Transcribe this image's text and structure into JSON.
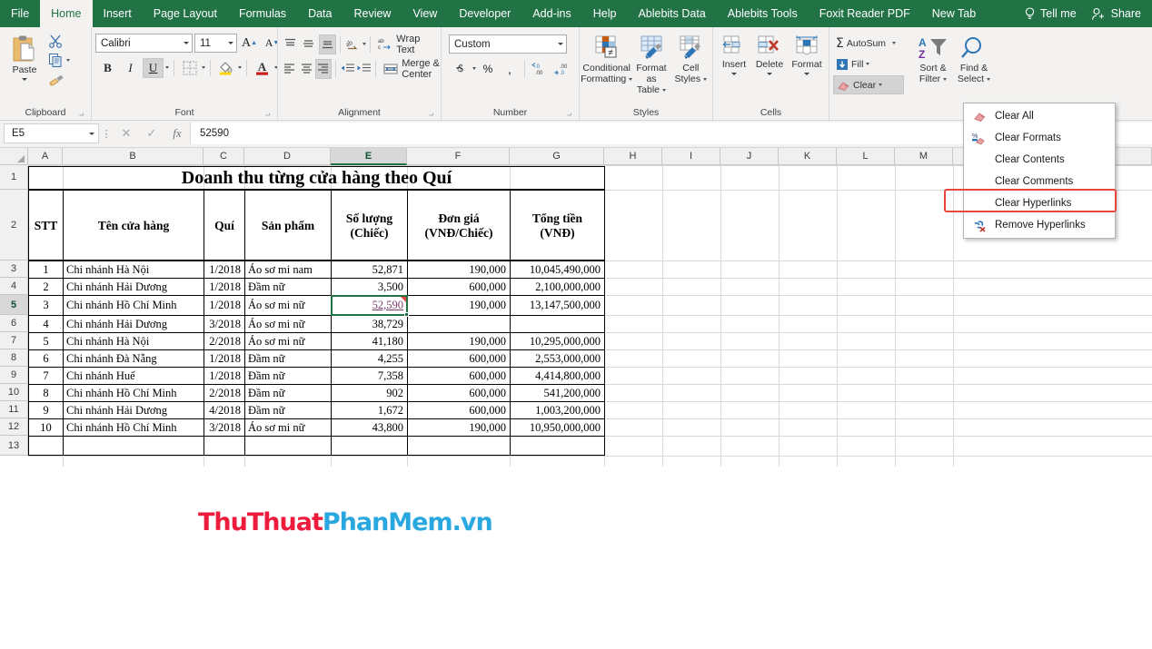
{
  "ribbon_tabs": [
    {
      "label": "File",
      "active": false
    },
    {
      "label": "Home",
      "active": true
    },
    {
      "label": "Insert",
      "active": false
    },
    {
      "label": "Page Layout",
      "active": false
    },
    {
      "label": "Formulas",
      "active": false
    },
    {
      "label": "Data",
      "active": false
    },
    {
      "label": "Review",
      "active": false
    },
    {
      "label": "View",
      "active": false
    },
    {
      "label": "Developer",
      "active": false
    },
    {
      "label": "Add-ins",
      "active": false
    },
    {
      "label": "Help",
      "active": false
    },
    {
      "label": "Ablebits Data",
      "active": false
    },
    {
      "label": "Ablebits Tools",
      "active": false
    },
    {
      "label": "Foxit Reader PDF",
      "active": false
    },
    {
      "label": "New Tab",
      "active": false
    }
  ],
  "titlebar": {
    "tell_me": "Tell me",
    "share": "Share"
  },
  "ribbon": {
    "clipboard": {
      "label": "Clipboard",
      "paste": "Paste",
      "cut": "Cut",
      "copy": "Copy",
      "format_painter": "Format Painter"
    },
    "font": {
      "label": "Font",
      "font_name": "Calibri",
      "font_size": "11",
      "grow_font": "A",
      "shrink_font": "A",
      "bold": "B",
      "italic": "I",
      "underline": "U"
    },
    "alignment": {
      "label": "Alignment",
      "wrap_text": "Wrap Text",
      "merge_center": "Merge & Center"
    },
    "number": {
      "label": "Number",
      "format": "Custom",
      "currency": "$",
      "percent": "%",
      "comma": ",",
      "decrease_decimal": ".00",
      "increase_decimal": ".00"
    },
    "styles": {
      "label": "Styles",
      "conditional_formatting": "Conditional\nFormatting",
      "conditional_line1": "Conditional",
      "conditional_line2": "Formatting",
      "format_as_table_line1": "Format as",
      "format_as_table_line2": "Table",
      "cell_styles_line1": "Cell",
      "cell_styles_line2": "Styles"
    },
    "cells": {
      "label": "Cells",
      "insert": "Insert",
      "delete": "Delete",
      "format": "Format"
    },
    "editing": {
      "autosum": "AutoSum",
      "fill": "Fill",
      "clear": "Clear",
      "sort_filter_line1": "Sort &",
      "sort_filter_line2": "Filter",
      "find_select_line1": "Find &",
      "find_select_line2": "Select"
    }
  },
  "clear_menu": {
    "items": [
      {
        "label": "Clear All",
        "icon": "eraser-icon",
        "highlighted": false
      },
      {
        "label": "Clear Formats",
        "icon": "clear-formats-icon",
        "highlighted": false
      },
      {
        "label": "Clear Contents",
        "icon": "none",
        "highlighted": false
      },
      {
        "label": "Clear Comments",
        "icon": "none",
        "highlighted": false
      },
      {
        "label": "Clear Hyperlinks",
        "icon": "none",
        "highlighted": true
      },
      {
        "label": "Remove Hyperlinks",
        "icon": "remove-hyperlink-icon",
        "highlighted": false
      }
    ],
    "highlight_color": "#e8453c"
  },
  "formula_bar": {
    "name_box": "E5",
    "cancel": "✕",
    "enter": "✓",
    "insert_function": "fx",
    "value": "52590"
  },
  "sheet": {
    "columns": [
      "A",
      "B",
      "C",
      "D",
      "E",
      "F",
      "G",
      "H",
      "I",
      "J",
      "K",
      "L",
      "M"
    ],
    "selected_column": "E",
    "rows": [
      "1",
      "2",
      "3",
      "4",
      "5",
      "6",
      "7",
      "8",
      "9",
      "10",
      "11",
      "12",
      "13"
    ],
    "selected_row": "5",
    "title": "Doanh thu từng cửa hàng theo Quí",
    "headers": [
      "STT",
      "Tên cửa hàng",
      "Quí",
      "Sản phẩm",
      "Số lượng\n(Chiếc)",
      "Đơn giá\n(VNĐ/Chiếc)",
      "Tổng tiền\n(VNĐ)"
    ],
    "header_lines": [
      {
        "l1": "STT",
        "l2": ""
      },
      {
        "l1": "Tên cửa hàng",
        "l2": ""
      },
      {
        "l1": "Quí",
        "l2": ""
      },
      {
        "l1": "Sản phẩm",
        "l2": ""
      },
      {
        "l1": "Số lượng",
        "l2": "(Chiếc)"
      },
      {
        "l1": "Đơn giá",
        "l2": "(VNĐ/Chiếc)"
      },
      {
        "l1": "Tổng tiền",
        "l2": "(VNĐ)"
      }
    ],
    "data": [
      {
        "stt": "1",
        "store": "Chi nhánh Hà Nội",
        "qui": "1/2018",
        "product": "Áo sơ mi nam",
        "qty": "52,871",
        "price": "190,000",
        "total": "10,045,490,000"
      },
      {
        "stt": "2",
        "store": "Chi nhánh Hải Dương",
        "qui": "1/2018",
        "product": "Đầm nữ",
        "qty": "3,500",
        "price": "600,000",
        "total": "2,100,000,000"
      },
      {
        "stt": "3",
        "store": "Chi nhánh Hồ Chí Minh",
        "qui": "1/2018",
        "product": "Áo sơ mi nữ",
        "qty": "52,590",
        "price": "190,000",
        "total": "13,147,500,000"
      },
      {
        "stt": "4",
        "store": "Chi nhánh Hải Dương",
        "qui": "3/2018",
        "product": "Áo sơ mi nữ",
        "qty": "38,729",
        "price": "",
        "total": ""
      },
      {
        "stt": "5",
        "store": "Chi nhánh Hà Nội",
        "qui": "2/2018",
        "product": "Áo sơ mi nữ",
        "qty": "41,180",
        "price": "190,000",
        "total": "10,295,000,000"
      },
      {
        "stt": "6",
        "store": "Chi nhánh Đà Nẵng",
        "qui": "1/2018",
        "product": "Đầm nữ",
        "qty": "4,255",
        "price": "600,000",
        "total": "2,553,000,000"
      },
      {
        "stt": "7",
        "store": "Chi nhánh Huế",
        "qui": "1/2018",
        "product": "Đầm nữ",
        "qty": "7,358",
        "price": "600,000",
        "total": "4,414,800,000"
      },
      {
        "stt": "8",
        "store": "Chi nhánh Hồ Chí Minh",
        "qui": "2/2018",
        "product": "Đầm nữ",
        "qty": "902",
        "price": "600,000",
        "total": "541,200,000"
      },
      {
        "stt": "9",
        "store": "Chi nhánh Hải Dương",
        "qui": "4/2018",
        "product": "Đầm nữ",
        "qty": "1,672",
        "price": "600,000",
        "total": "1,003,200,000"
      },
      {
        "stt": "10",
        "store": "Chi nhánh Hồ Chí Minh",
        "qui": "3/2018",
        "product": "Áo sơ mi nữ",
        "qty": "43,800",
        "price": "190,000",
        "total": "10,950,000,000"
      }
    ],
    "selected_cell": {
      "ref": "E5",
      "display": "52,590",
      "has_comment": true,
      "is_hyperlink": true,
      "hyperlink_color": "#7a3b6b"
    }
  },
  "watermark": {
    "part1": "ThuThuat",
    "part2": "PhanMem",
    "part3": ".vn",
    "color1": "#ed1c3c",
    "color2": "#29a8e0"
  },
  "theme": {
    "ribbon_green": "#217346",
    "ribbon_bg": "#f3f2f1"
  }
}
